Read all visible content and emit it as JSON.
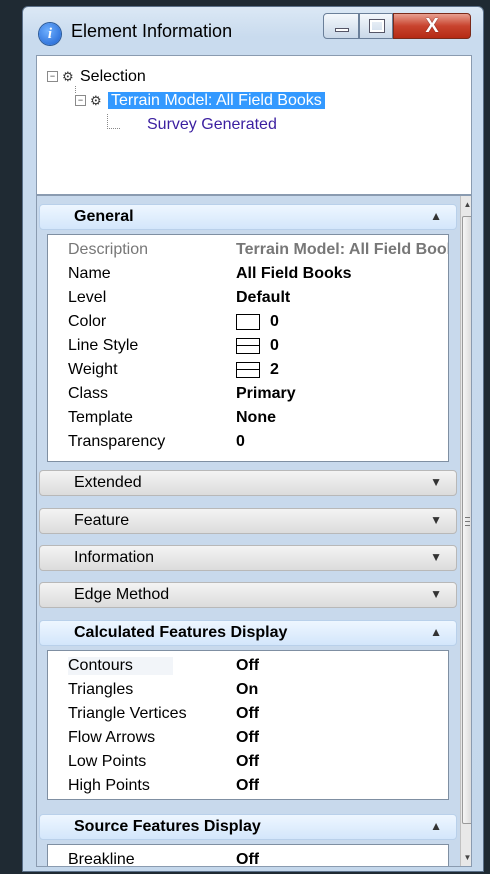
{
  "window": {
    "title": "Element Information",
    "icon": "info-icon",
    "close_glyph": "X"
  },
  "tree": {
    "root": {
      "label": "Selection",
      "expander": "−"
    },
    "child": {
      "label": "Terrain Model: All Field Books",
      "expander": "−"
    },
    "leaf": {
      "label": "Survey Generated"
    }
  },
  "sections": {
    "general": {
      "label": "General",
      "rows": [
        {
          "key": "Description",
          "value": "Terrain Model: All Field Books"
        },
        {
          "key": "Name",
          "value": "All Field Books"
        },
        {
          "key": "Level",
          "value": "Default"
        },
        {
          "key": "Color",
          "value": "0"
        },
        {
          "key": "Line Style",
          "value": "0"
        },
        {
          "key": "Weight",
          "value": "2"
        },
        {
          "key": "Class",
          "value": "Primary"
        },
        {
          "key": "Template",
          "value": "None"
        },
        {
          "key": "Transparency",
          "value": "0"
        }
      ]
    },
    "extended": {
      "label": "Extended"
    },
    "feature": {
      "label": "Feature"
    },
    "information": {
      "label": "Information"
    },
    "edge_method": {
      "label": "Edge Method"
    },
    "calculated": {
      "label": "Calculated Features Display",
      "rows": [
        {
          "key": "Contours",
          "value": "Off"
        },
        {
          "key": "Triangles",
          "value": "On"
        },
        {
          "key": "Triangle Vertices",
          "value": "Off"
        },
        {
          "key": "Flow Arrows",
          "value": "Off"
        },
        {
          "key": "Low Points",
          "value": "Off"
        },
        {
          "key": "High Points",
          "value": "Off"
        }
      ]
    },
    "source": {
      "label": "Source Features Display",
      "rows": [
        {
          "key": "Breakline",
          "value": "Off"
        }
      ]
    }
  },
  "icons": {
    "collapse": "chevron-up-icon",
    "expand": "chevron-down-icon"
  },
  "colors": {
    "selection": "#3399ff",
    "leaf_text": "#3b1fa0",
    "section_open": "#d3e6fb"
  }
}
